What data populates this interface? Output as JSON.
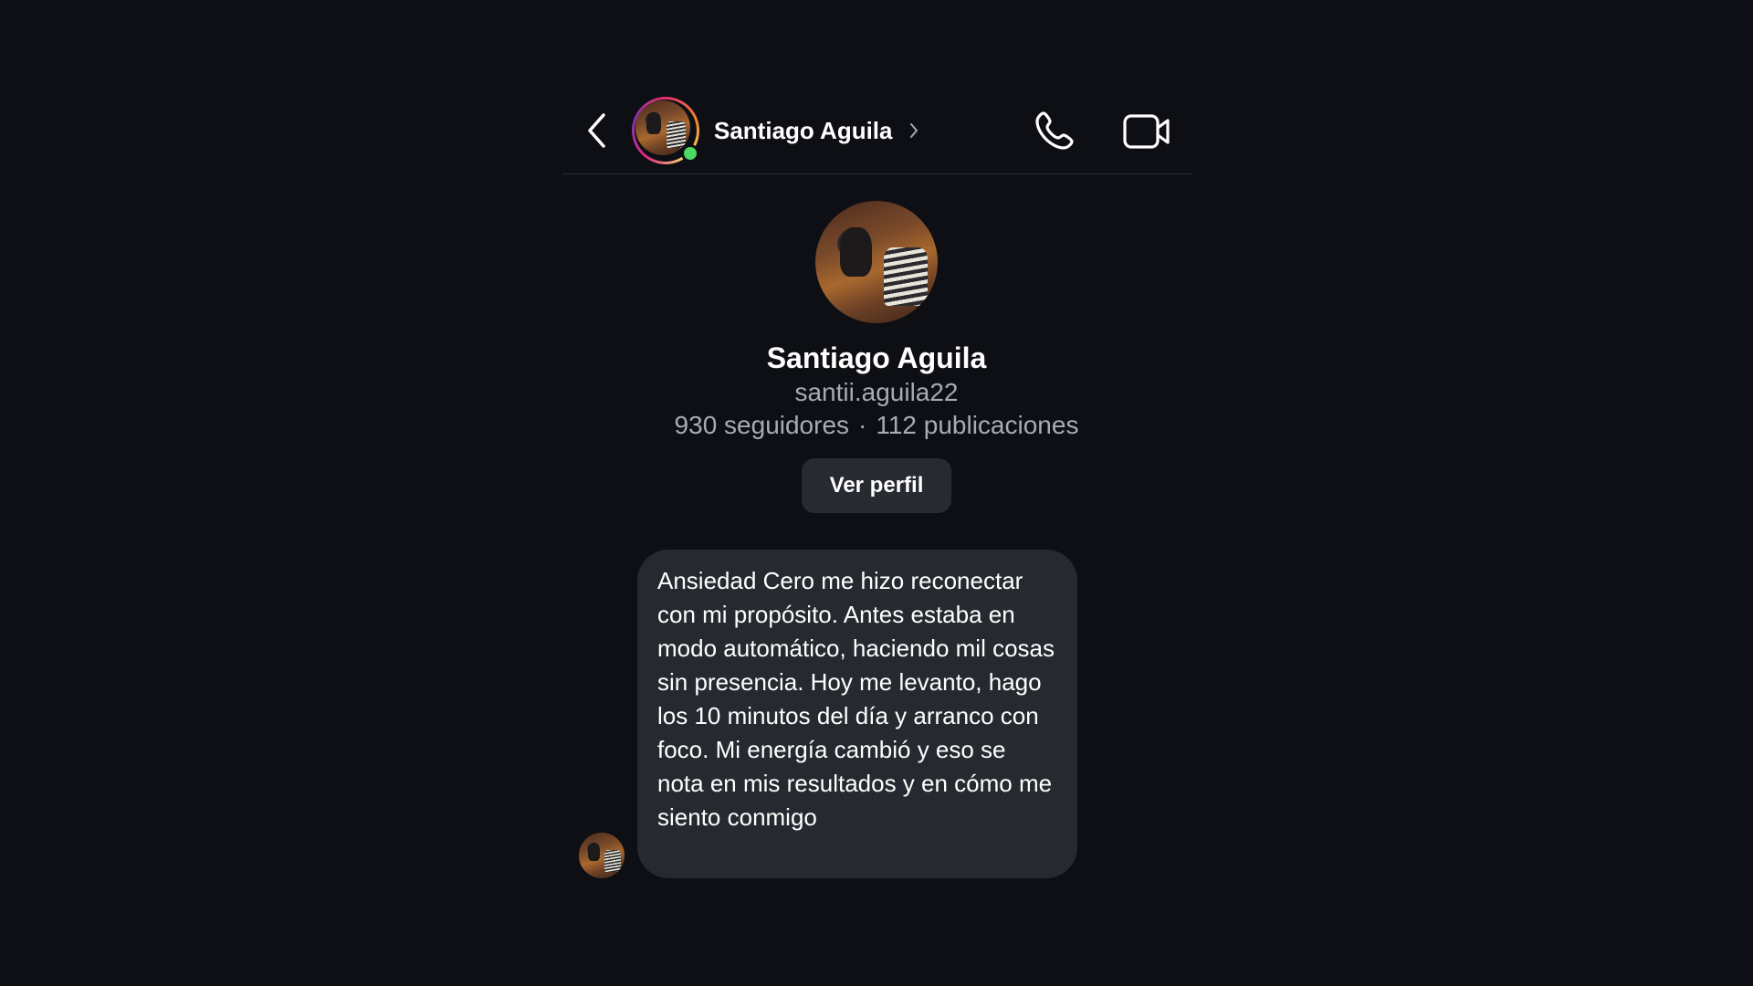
{
  "header": {
    "contact_name": "Santiago Aguila",
    "online": true
  },
  "profile": {
    "name": "Santiago Aguila",
    "username": "santii.aguila22",
    "followers": "930 seguidores",
    "separator": "·",
    "posts": "112 publicaciones",
    "view_profile_label": "Ver perfil"
  },
  "messages": [
    {
      "from": "Santiago Aguila",
      "text": "Ansiedad Cero me hizo reconectar con mi propósito. Antes estaba en modo automático, haciendo mil cosas sin presencia. Hoy me levanto, hago los 10 minutos del día y arranco con foco. Mi energía cambió y eso se nota en mis resultados y en cómo me siento conmigo"
    }
  ],
  "icons": {
    "back": "chevron-left-icon",
    "call": "phone-icon",
    "video": "video-camera-icon",
    "header_chevron": "chevron-right-icon"
  },
  "colors": {
    "background": "#0d0f14",
    "bubble": "#26292f",
    "button": "#272a30",
    "secondary_text": "#a8abb2",
    "online": "#4cd964"
  }
}
